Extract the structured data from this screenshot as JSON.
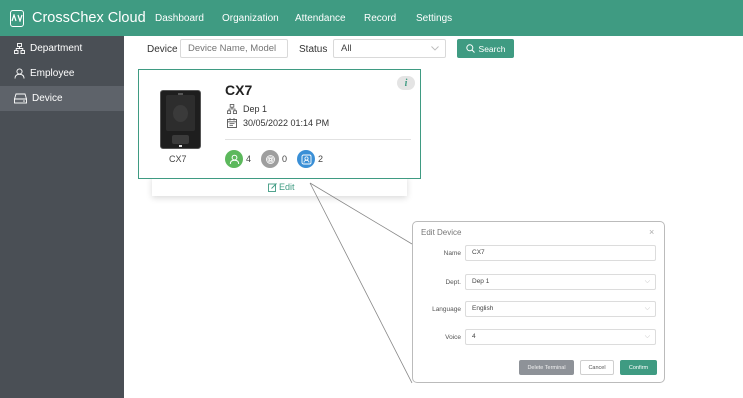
{
  "app": {
    "title": "CrossChex Cloud",
    "logo_text": "ANVIZ"
  },
  "nav": {
    "items": [
      "Dashboard",
      "Organization",
      "Attendance",
      "Record",
      "Settings"
    ]
  },
  "sidebar": {
    "items": [
      {
        "label": "Department",
        "icon": "department-icon"
      },
      {
        "label": "Employee",
        "icon": "employee-icon"
      },
      {
        "label": "Device",
        "icon": "device-icon",
        "active": true
      }
    ]
  },
  "filters": {
    "device_label": "Device",
    "device_placeholder": "Device Name, Model",
    "status_label": "Status",
    "status_value": "All",
    "search_label": "Search"
  },
  "device_card": {
    "name": "CX7",
    "model": "CX7",
    "department": "Dep 1",
    "datetime": "30/05/2022 01:14 PM",
    "info_label": "i",
    "stats": {
      "users": "4",
      "fingerprints": "0",
      "faces": "2"
    },
    "edit_label": "Edit"
  },
  "edit_dialog": {
    "title": "Edit Device",
    "close": "×",
    "fields": [
      {
        "label": "Name",
        "value": "CX7"
      },
      {
        "label": "Dept.",
        "value": "Dep 1"
      },
      {
        "label": "Language",
        "value": "English"
      },
      {
        "label": "Voice",
        "value": "4"
      }
    ],
    "buttons": {
      "delete": "Delete Terminal",
      "cancel": "Cancel",
      "confirm": "Confirm"
    }
  },
  "colors": {
    "brand": "#3f9b82",
    "sidebar": "#4a4f55",
    "sidebar_active": "#5e636a",
    "users": "#5cb85c",
    "fingerprints": "#9e9e9e",
    "faces": "#3a8fd6"
  }
}
